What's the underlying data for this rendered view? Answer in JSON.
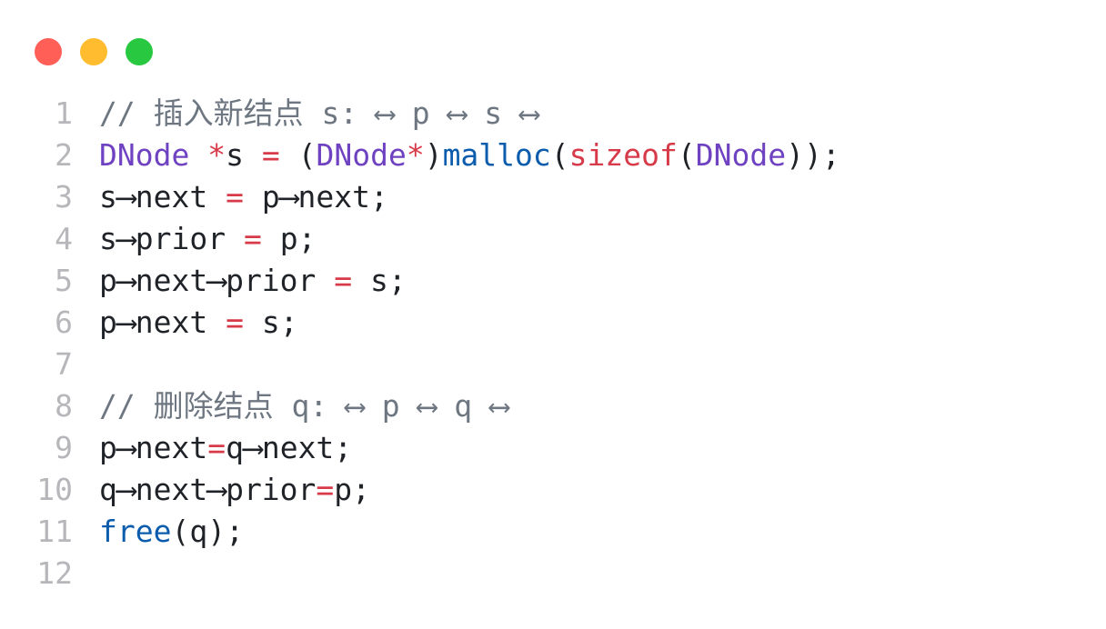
{
  "window": {
    "buttons": [
      {
        "name": "close",
        "color": "#ff5f57"
      },
      {
        "name": "minimize",
        "color": "#febc2e"
      },
      {
        "name": "maximize",
        "color": "#28c840"
      }
    ]
  },
  "colors": {
    "comment": "#6e7781",
    "type": "#6f42c1",
    "operator": "#d73a49",
    "keyword": "#d73a49",
    "function": "#0b5cad",
    "plain": "#1f2328",
    "line_number": "#b7b7bb"
  },
  "code": {
    "lines": [
      {
        "n": "1",
        "tokens": [
          {
            "t": "// 插入新结点 s: ⟷ p ⟷ s ⟷",
            "k": "comment"
          }
        ]
      },
      {
        "n": "2",
        "tokens": [
          {
            "t": "DNode",
            "k": "type"
          },
          {
            "t": " ",
            "k": "plain"
          },
          {
            "t": "*",
            "k": "op"
          },
          {
            "t": "s ",
            "k": "plain"
          },
          {
            "t": "=",
            "k": "op"
          },
          {
            "t": " (",
            "k": "plain"
          },
          {
            "t": "DNode",
            "k": "type"
          },
          {
            "t": "*",
            "k": "op"
          },
          {
            "t": ")",
            "k": "plain"
          },
          {
            "t": "malloc",
            "k": "fn"
          },
          {
            "t": "(",
            "k": "plain"
          },
          {
            "t": "sizeof",
            "k": "kw"
          },
          {
            "t": "(",
            "k": "plain"
          },
          {
            "t": "DNode",
            "k": "type"
          },
          {
            "t": "));",
            "k": "plain"
          }
        ]
      },
      {
        "n": "3",
        "tokens": [
          {
            "t": "s⟶next ",
            "k": "plain"
          },
          {
            "t": "=",
            "k": "op"
          },
          {
            "t": " p⟶next;",
            "k": "plain"
          }
        ]
      },
      {
        "n": "4",
        "tokens": [
          {
            "t": "s⟶prior ",
            "k": "plain"
          },
          {
            "t": "=",
            "k": "op"
          },
          {
            "t": " p;",
            "k": "plain"
          }
        ]
      },
      {
        "n": "5",
        "tokens": [
          {
            "t": "p⟶next⟶prior ",
            "k": "plain"
          },
          {
            "t": "=",
            "k": "op"
          },
          {
            "t": " s;",
            "k": "plain"
          }
        ]
      },
      {
        "n": "6",
        "tokens": [
          {
            "t": "p⟶next ",
            "k": "plain"
          },
          {
            "t": "=",
            "k": "op"
          },
          {
            "t": " s;",
            "k": "plain"
          }
        ]
      },
      {
        "n": "7",
        "tokens": []
      },
      {
        "n": "8",
        "tokens": [
          {
            "t": "// 删除结点 q: ⟷ p ⟷ q ⟷",
            "k": "comment"
          }
        ]
      },
      {
        "n": "9",
        "tokens": [
          {
            "t": "p⟶next",
            "k": "plain"
          },
          {
            "t": "=",
            "k": "op"
          },
          {
            "t": "q⟶next;",
            "k": "plain"
          }
        ]
      },
      {
        "n": "10",
        "tokens": [
          {
            "t": "q⟶next⟶prior",
            "k": "plain"
          },
          {
            "t": "=",
            "k": "op"
          },
          {
            "t": "p;",
            "k": "plain"
          }
        ]
      },
      {
        "n": "11",
        "tokens": [
          {
            "t": "free",
            "k": "fn"
          },
          {
            "t": "(q);",
            "k": "plain"
          }
        ]
      },
      {
        "n": "12",
        "tokens": []
      }
    ]
  }
}
